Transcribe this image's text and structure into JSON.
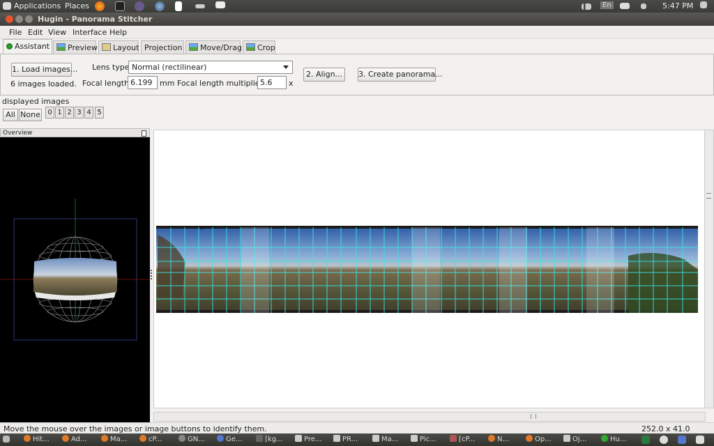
{
  "system_panel": {
    "applications": "Applications",
    "places": "Places",
    "keyboard_layout": "En",
    "time": "5:47 PM"
  },
  "window": {
    "title": "Hugin - Panorama Stitcher"
  },
  "menu": [
    "File",
    "Edit",
    "View",
    "Interface",
    "Help"
  ],
  "tabs": [
    "Assistant",
    "Preview",
    "Layout",
    "Projection",
    "Move/Drag",
    "Crop"
  ],
  "assistant": {
    "load_button": "1. Load images...",
    "images_loaded": "6 images loaded.",
    "lens_type_label": "Lens type:",
    "lens_type_value": "Normal (rectilinear)",
    "focal_length_label": "Focal length:",
    "focal_length_value": "6.199",
    "focal_length_unit": "mm",
    "multiplier_label": "Focal length multiplier:",
    "multiplier_value": "5.6",
    "multiplier_unit": "x",
    "align_button": "2. Align...",
    "create_button": "3. Create panorama..."
  },
  "displayed_images": {
    "label": "displayed images",
    "all": "All",
    "none": "None",
    "numbers": [
      "0",
      "1",
      "2",
      "3",
      "4",
      "5"
    ]
  },
  "overview": {
    "title": "Overview"
  },
  "status": {
    "message": "Move the mouse over the images or image buttons to identify them.",
    "dimensions": "252.0 x 41.0"
  },
  "taskbar": [
    "Hit...",
    "Ad...",
    "Ma...",
    "cP...",
    "GN...",
    "Ge...",
    "[kg...",
    "Pre...",
    "PR...",
    "Ma...",
    "Pic...",
    "[cP...",
    "N...",
    "Op...",
    "Oj...",
    "Hu..."
  ]
}
